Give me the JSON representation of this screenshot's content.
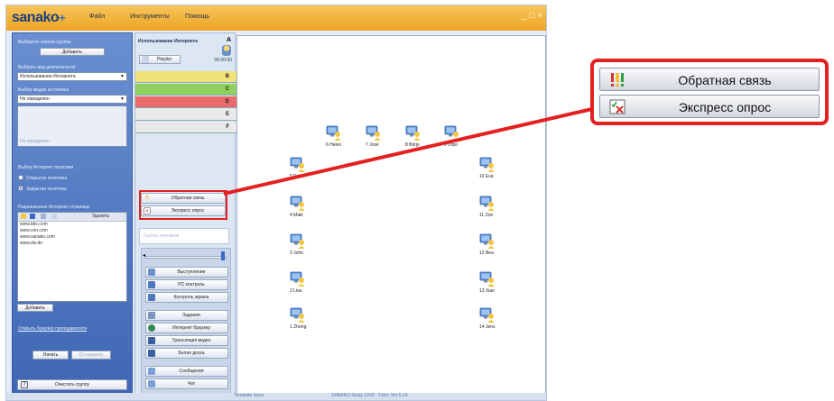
{
  "app": {
    "logo": "sanako",
    "logo_plus": "+",
    "menu": [
      "Файл",
      "Инструменты",
      "Помощь"
    ],
    "window_controls": "_ □ ×"
  },
  "left_panel": {
    "group_label": "Выберите членов группы",
    "add_button": "Добавить",
    "activity_label": "Выбрать вид деятельности",
    "activity_value": "Использование Интернета",
    "source_label": "Выбор медиа источника",
    "source_value": "Не определен",
    "source_detail": "Не определен",
    "policy_label": "Выбор Интернет политики",
    "policy_open": "Открытая политика",
    "policy_closed": "Закрытая политика",
    "allowed_label": "Разрешенные Интернет страницы",
    "delete_label": "Удалить",
    "urls": [
      "www.bbc.com",
      "www.cnn.com",
      "www.sanako.com",
      "www.dw.de"
    ],
    "add_url_button": "Добавить",
    "open_browser_link": "Открыть браузер преподавателя",
    "start_button": "Начать",
    "stop_button": "Остановить",
    "clear_group_button": "Очистить группу"
  },
  "middle_panel": {
    "activity_title": "Использование Интернета",
    "group_letter": "A",
    "playlist_button": "Playlist",
    "timer": "00:00:00",
    "groups": [
      {
        "letter": "B",
        "color": "#f1e27a"
      },
      {
        "letter": "C",
        "color": "#8fd05e"
      },
      {
        "letter": "D",
        "color": "#e86a6a"
      },
      {
        "letter": "E",
        "color": "#e9e9e9"
      },
      {
        "letter": "F",
        "color": "#e9e9e9"
      }
    ],
    "feedback_button": "Обратная связь",
    "quiz_button": "Экспресс опрос",
    "names_placeholder": "Группы учеников",
    "tools": [
      {
        "label": "Выступление",
        "icon": "speech-icon",
        "color": "#6b8fc8"
      },
      {
        "label": "PC контроль",
        "icon": "pc-control-icon",
        "color": "#4f78bd"
      },
      {
        "label": "Контроль экрана",
        "icon": "screen-control-icon",
        "color": "#4f78bd"
      },
      {
        "label": "Задания",
        "icon": "tasks-icon",
        "color": "#7c95c0"
      },
      {
        "label": "Интернет браузер",
        "icon": "browser-icon",
        "color": "#2e8b57"
      },
      {
        "label": "Трансляция видео",
        "icon": "video-icon",
        "color": "#3b5fa0"
      },
      {
        "label": "Белая доска",
        "icon": "whiteboard-icon",
        "color": "#3b5fa0"
      },
      {
        "label": "Сообщения",
        "icon": "messages-icon",
        "color": "#7aa0d8"
      },
      {
        "label": "Чат",
        "icon": "chat-icon",
        "color": "#7aa0d8"
      }
    ]
  },
  "classroom": {
    "students": [
      {
        "name": "6 Helen"
      },
      {
        "name": "7 José"
      },
      {
        "name": "8 Börje"
      },
      {
        "name": "9 Urpo"
      },
      {
        "name": "5 Peter"
      },
      {
        "name": "10 Eva"
      },
      {
        "name": "4 Maik"
      },
      {
        "name": "11 Zoe"
      },
      {
        "name": "3 John"
      },
      {
        "name": "12 Bea"
      },
      {
        "name": "2 Lisa"
      },
      {
        "name": "13 Xiao"
      },
      {
        "name": "1 Zhong"
      },
      {
        "name": "14 Jens"
      }
    ]
  },
  "statusbar": {
    "template": "Template class",
    "version": "SANAKO Study 1200 - Tutor. Ver 5.10"
  },
  "zoom": {
    "feedback_label": "Обратная связь",
    "quiz_label": "Экспресс опрос"
  },
  "colors": {
    "callout": "#e42020",
    "titlebar": "#eda526",
    "left_panel": "#4a72bb"
  }
}
